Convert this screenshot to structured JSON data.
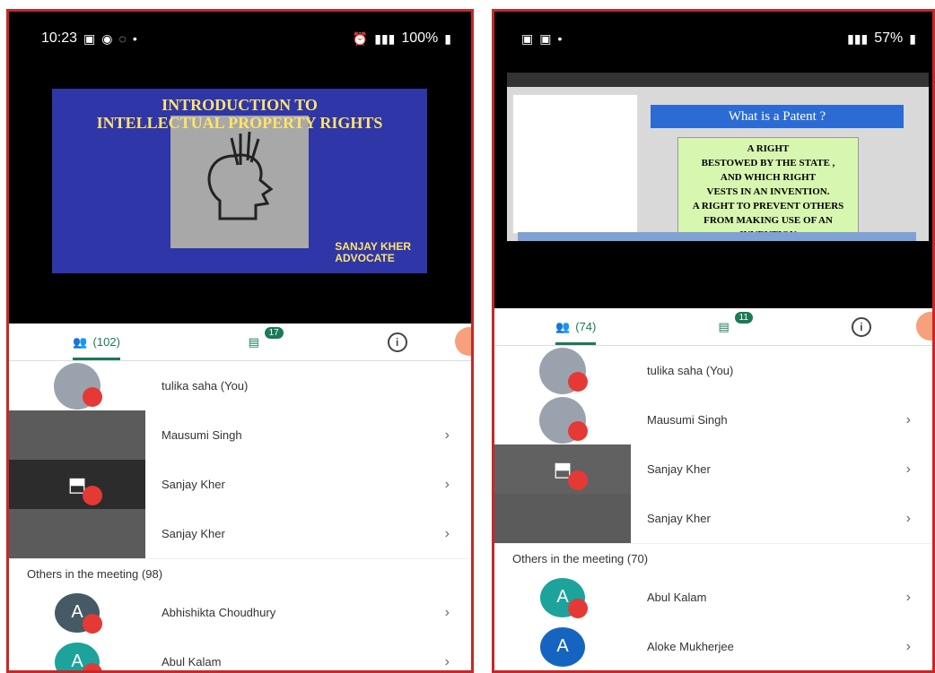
{
  "left": {
    "status": {
      "time": "10:23",
      "battery": "100%"
    },
    "slide": {
      "title_line1": "INTRODUCTION TO",
      "title_line2": "INTELLECTUAL PROPERTY RIGHTS",
      "author_line1": "SANJAY KHER",
      "author_line2": "ADVOCATE"
    },
    "tabs": {
      "people": "(102)",
      "chat_badge": "17"
    },
    "participants": [
      {
        "name": "tulika saha (You)"
      },
      {
        "name": "Mausumi Singh"
      },
      {
        "name": "Sanjay Kher"
      },
      {
        "name": "Sanjay Kher"
      }
    ],
    "others_label": "Others in the meeting (98)",
    "others": [
      {
        "letter": "A",
        "name": "Abhishikta Choudhury",
        "color": "#455a64"
      },
      {
        "letter": "A",
        "name": "Abul Kalam",
        "color": "#1ba39c"
      }
    ]
  },
  "right": {
    "status": {
      "battery": "57%"
    },
    "slide": {
      "title": "What is a Patent ?",
      "body": [
        "A RIGHT",
        "BESTOWED BY THE STATE ,",
        "AND WHICH RIGHT",
        "VESTS IN AN INVENTION.",
        "A RIGHT TO PREVENT OTHERS",
        "FROM MAKING USE OF AN",
        "INVENTION"
      ]
    },
    "tabs": {
      "people": "(74)",
      "chat_badge": "11"
    },
    "participants": [
      {
        "name": "tulika saha (You)"
      },
      {
        "name": "Mausumi Singh"
      },
      {
        "name": "Sanjay Kher"
      },
      {
        "name": "Sanjay Kher"
      }
    ],
    "others_label": "Others in the meeting (70)",
    "others": [
      {
        "letter": "A",
        "name": "Abul Kalam",
        "color": "#1ba39c"
      },
      {
        "letter": "A",
        "name": "Aloke Mukherjee",
        "color": "#1565c0"
      }
    ]
  },
  "icons": {
    "people": "people-icon",
    "chat": "chat-icon",
    "info": "info-icon",
    "mute": "mic-off-icon",
    "chevron": "chevron-right-icon",
    "present": "screen-share-icon"
  }
}
